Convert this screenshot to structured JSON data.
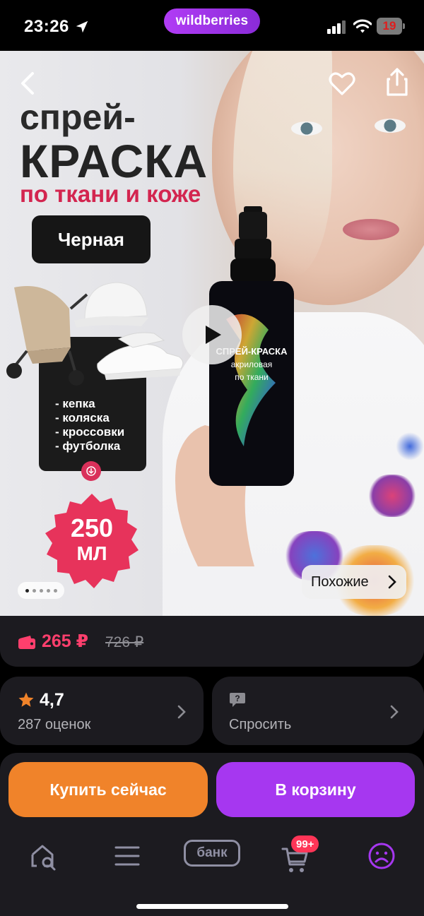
{
  "status_bar": {
    "time": "23:26",
    "brand": "wildberries",
    "battery_level": "19",
    "icons": [
      "location-arrow-icon",
      "signal-icon",
      "wifi-icon",
      "battery-icon"
    ]
  },
  "product_image": {
    "headline_line1": "спрей-",
    "headline_line2": "КРАСКА",
    "headline_line3": "по ткани и коже",
    "color_label": "Черная",
    "use_cases": [
      "кепка",
      "коляска",
      "кроссовки",
      "футболка"
    ],
    "volume_number": "250",
    "volume_unit": "МЛ",
    "pager": {
      "total": 5,
      "active_index": 0
    },
    "similar_label": "Похожие",
    "icons": [
      "back-icon",
      "heart-icon",
      "share-icon",
      "play-icon",
      "chevron-right-icon"
    ]
  },
  "price": {
    "current": "265 ₽",
    "old": "726 ₽",
    "icon": "wallet-icon"
  },
  "rating": {
    "value": "4,7",
    "count_label": "287 оценок",
    "icon": "star-icon"
  },
  "ask": {
    "label": "Спросить",
    "icon": "question-bubble-icon"
  },
  "actions": {
    "buy_now_label": "Купить сейчас",
    "add_to_cart_label": "В корзину"
  },
  "bottom_nav": {
    "bank_label": "банк",
    "cart_count": "99+",
    "items": [
      "home-search-icon",
      "menu-icon",
      "bank-icon",
      "cart-icon",
      "profile-icon"
    ]
  },
  "colors": {
    "brand_purple": "#a637f0",
    "buy_orange": "#f0832a",
    "price_red": "#ff3f6d",
    "card_bg": "#1c1b20",
    "rating_star": "#f0832a"
  }
}
